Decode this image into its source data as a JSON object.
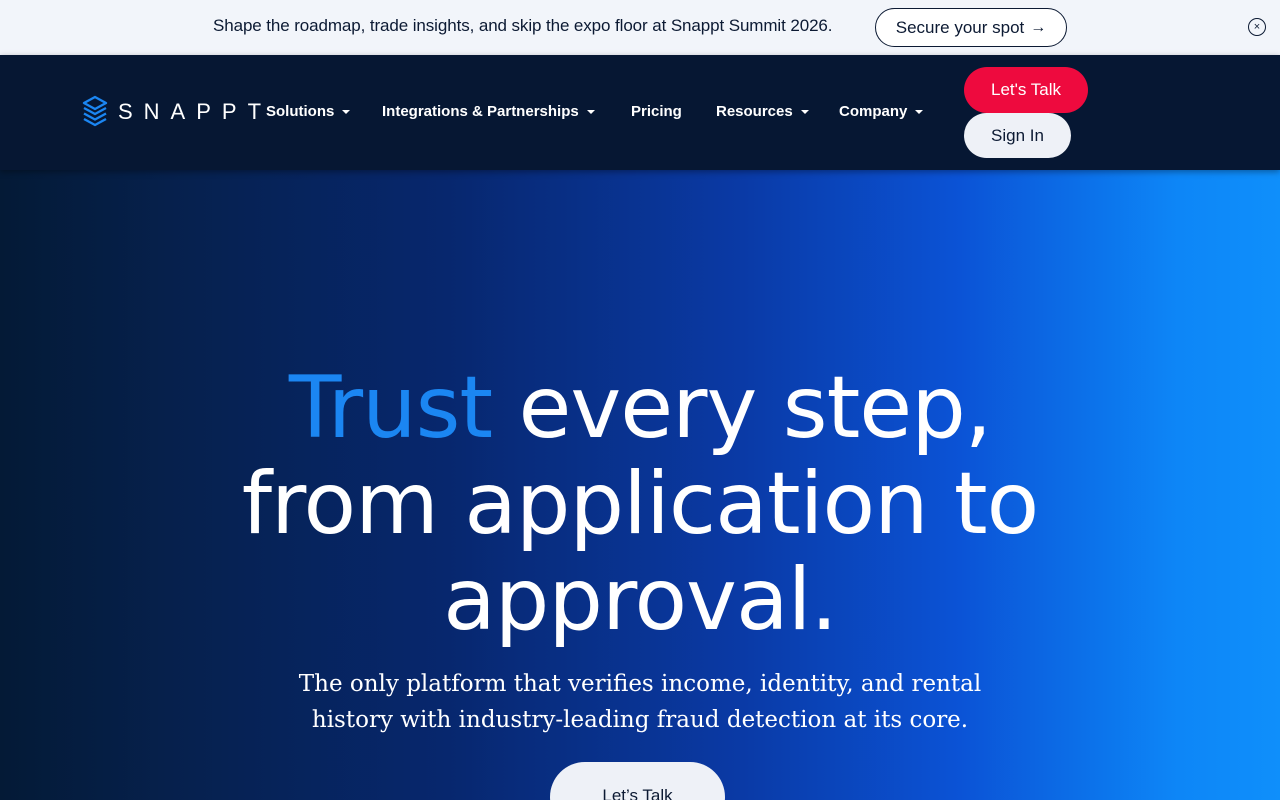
{
  "announcement": {
    "text": "Shape the roadmap, trade insights, and skip the expo floor at Snappt Summit 2026.",
    "cta_label": "Secure your spot",
    "cta_arrow": "→",
    "close_icon": "×"
  },
  "nav": {
    "logo_text": "SNAPPT",
    "items": [
      {
        "label": "Solutions",
        "has_dropdown": true
      },
      {
        "label": "Integrations & Partnerships",
        "has_dropdown": true
      },
      {
        "label": "Pricing",
        "has_dropdown": false
      },
      {
        "label": "Resources",
        "has_dropdown": true
      },
      {
        "label": "Company",
        "has_dropdown": true
      }
    ],
    "lets_talk_label": "Let's Talk",
    "sign_in_label": "Sign In"
  },
  "hero": {
    "headline_accent": "Trust",
    "headline_line1_rest": " every step,",
    "headline_line2": "from application to",
    "headline_line3": "approval.",
    "subheadline": "The only platform that verifies income, identity, and rental history with industry-leading fraud detection at its core.",
    "cta_label": "Let’s Talk"
  },
  "colors": {
    "accent_red": "#ee0a3e",
    "accent_blue": "#1b86f2",
    "nav_bg": "#061733",
    "announcement_bg": "#f2f5fa"
  }
}
